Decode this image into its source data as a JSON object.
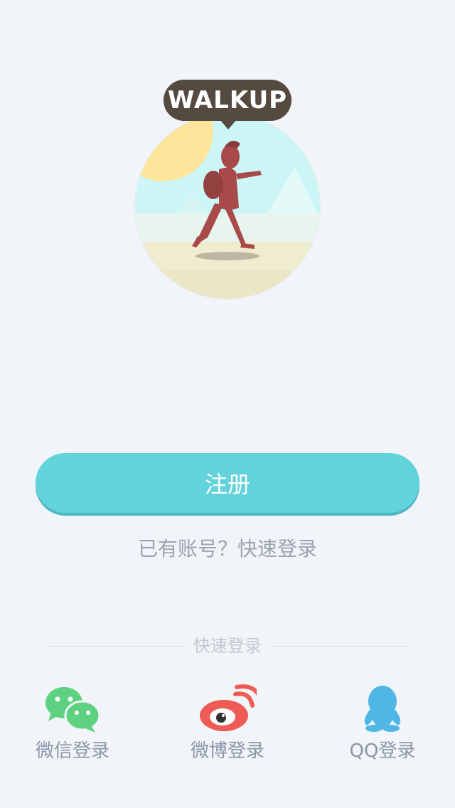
{
  "brand": {
    "logo_text": "WALKUP"
  },
  "actions": {
    "register_label": "注册",
    "login_prompt": "已有账号？快速登录"
  },
  "quick_login": {
    "section_label": "快速登录",
    "providers": [
      {
        "id": "wechat",
        "label": "微信登录",
        "icon": "wechat-icon",
        "color": "#5dd180"
      },
      {
        "id": "weibo",
        "label": "微博登录",
        "icon": "weibo-icon",
        "color": "#ee5b55"
      },
      {
        "id": "qq",
        "label": "QQ登录",
        "icon": "qq-icon",
        "color": "#4fb6e6"
      }
    ]
  },
  "colors": {
    "background": "#f1f4f8",
    "primary_button": "#62d2db",
    "badge": "#544a40",
    "muted_text": "#9aa3b0"
  }
}
